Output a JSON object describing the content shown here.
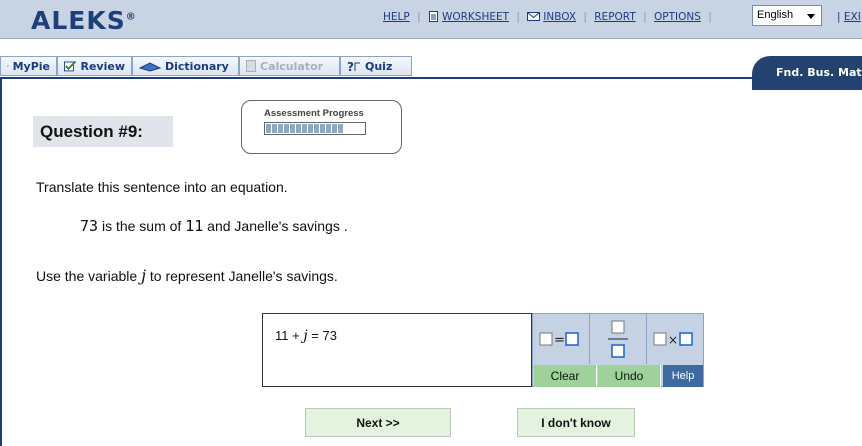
{
  "brand": {
    "logo": "ALEKS",
    "reg": "®"
  },
  "top_links": {
    "help": "HELP",
    "worksheet": "WORKSHEET",
    "inbox": "INBOX",
    "report": "REPORT",
    "options": "OPTIONS",
    "exit": "EXI"
  },
  "language": {
    "selected": "English"
  },
  "nav": {
    "tabs": [
      {
        "label": "MyPie",
        "icon": "pie-icon",
        "enabled": true
      },
      {
        "label": "Review",
        "icon": "checkmark-icon",
        "enabled": true
      },
      {
        "label": "Dictionary",
        "icon": "book-icon",
        "enabled": true
      },
      {
        "label": "Calculator",
        "icon": "calculator-icon",
        "enabled": false
      },
      {
        "label": "Quiz",
        "icon": "quiz-icon",
        "enabled": true
      }
    ],
    "course": "Fnd. Bus. Matl"
  },
  "question": {
    "label": "Question #9:",
    "progress_title": "Assessment Progress",
    "progress_fraction": 0.8,
    "instruction": "Translate this sentence into an equation.",
    "sentence": {
      "num1": "73",
      "mid": "is the sum of",
      "num2": "11",
      "tail": "and Janelle's savings",
      "period": "."
    },
    "variable_prefix": "Use the variable",
    "variable": "j",
    "variable_suffix": "to represent Janelle's savings."
  },
  "answer": {
    "left": "11 + ",
    "var": "j",
    "right": " = 73"
  },
  "palette": {
    "buttons": [
      "equals-template-icon",
      "fraction-template-icon",
      "times-template-icon"
    ],
    "clear": "Clear",
    "undo": "Undo",
    "help": "Help"
  },
  "actions": {
    "next": "Next >>",
    "dont_know": "I don't know"
  },
  "colors": {
    "header_bg": "#c8d4e4",
    "brand": "#1f3f7a",
    "accent_green": "#9fd29a",
    "help_blue": "#3d6aa0"
  }
}
